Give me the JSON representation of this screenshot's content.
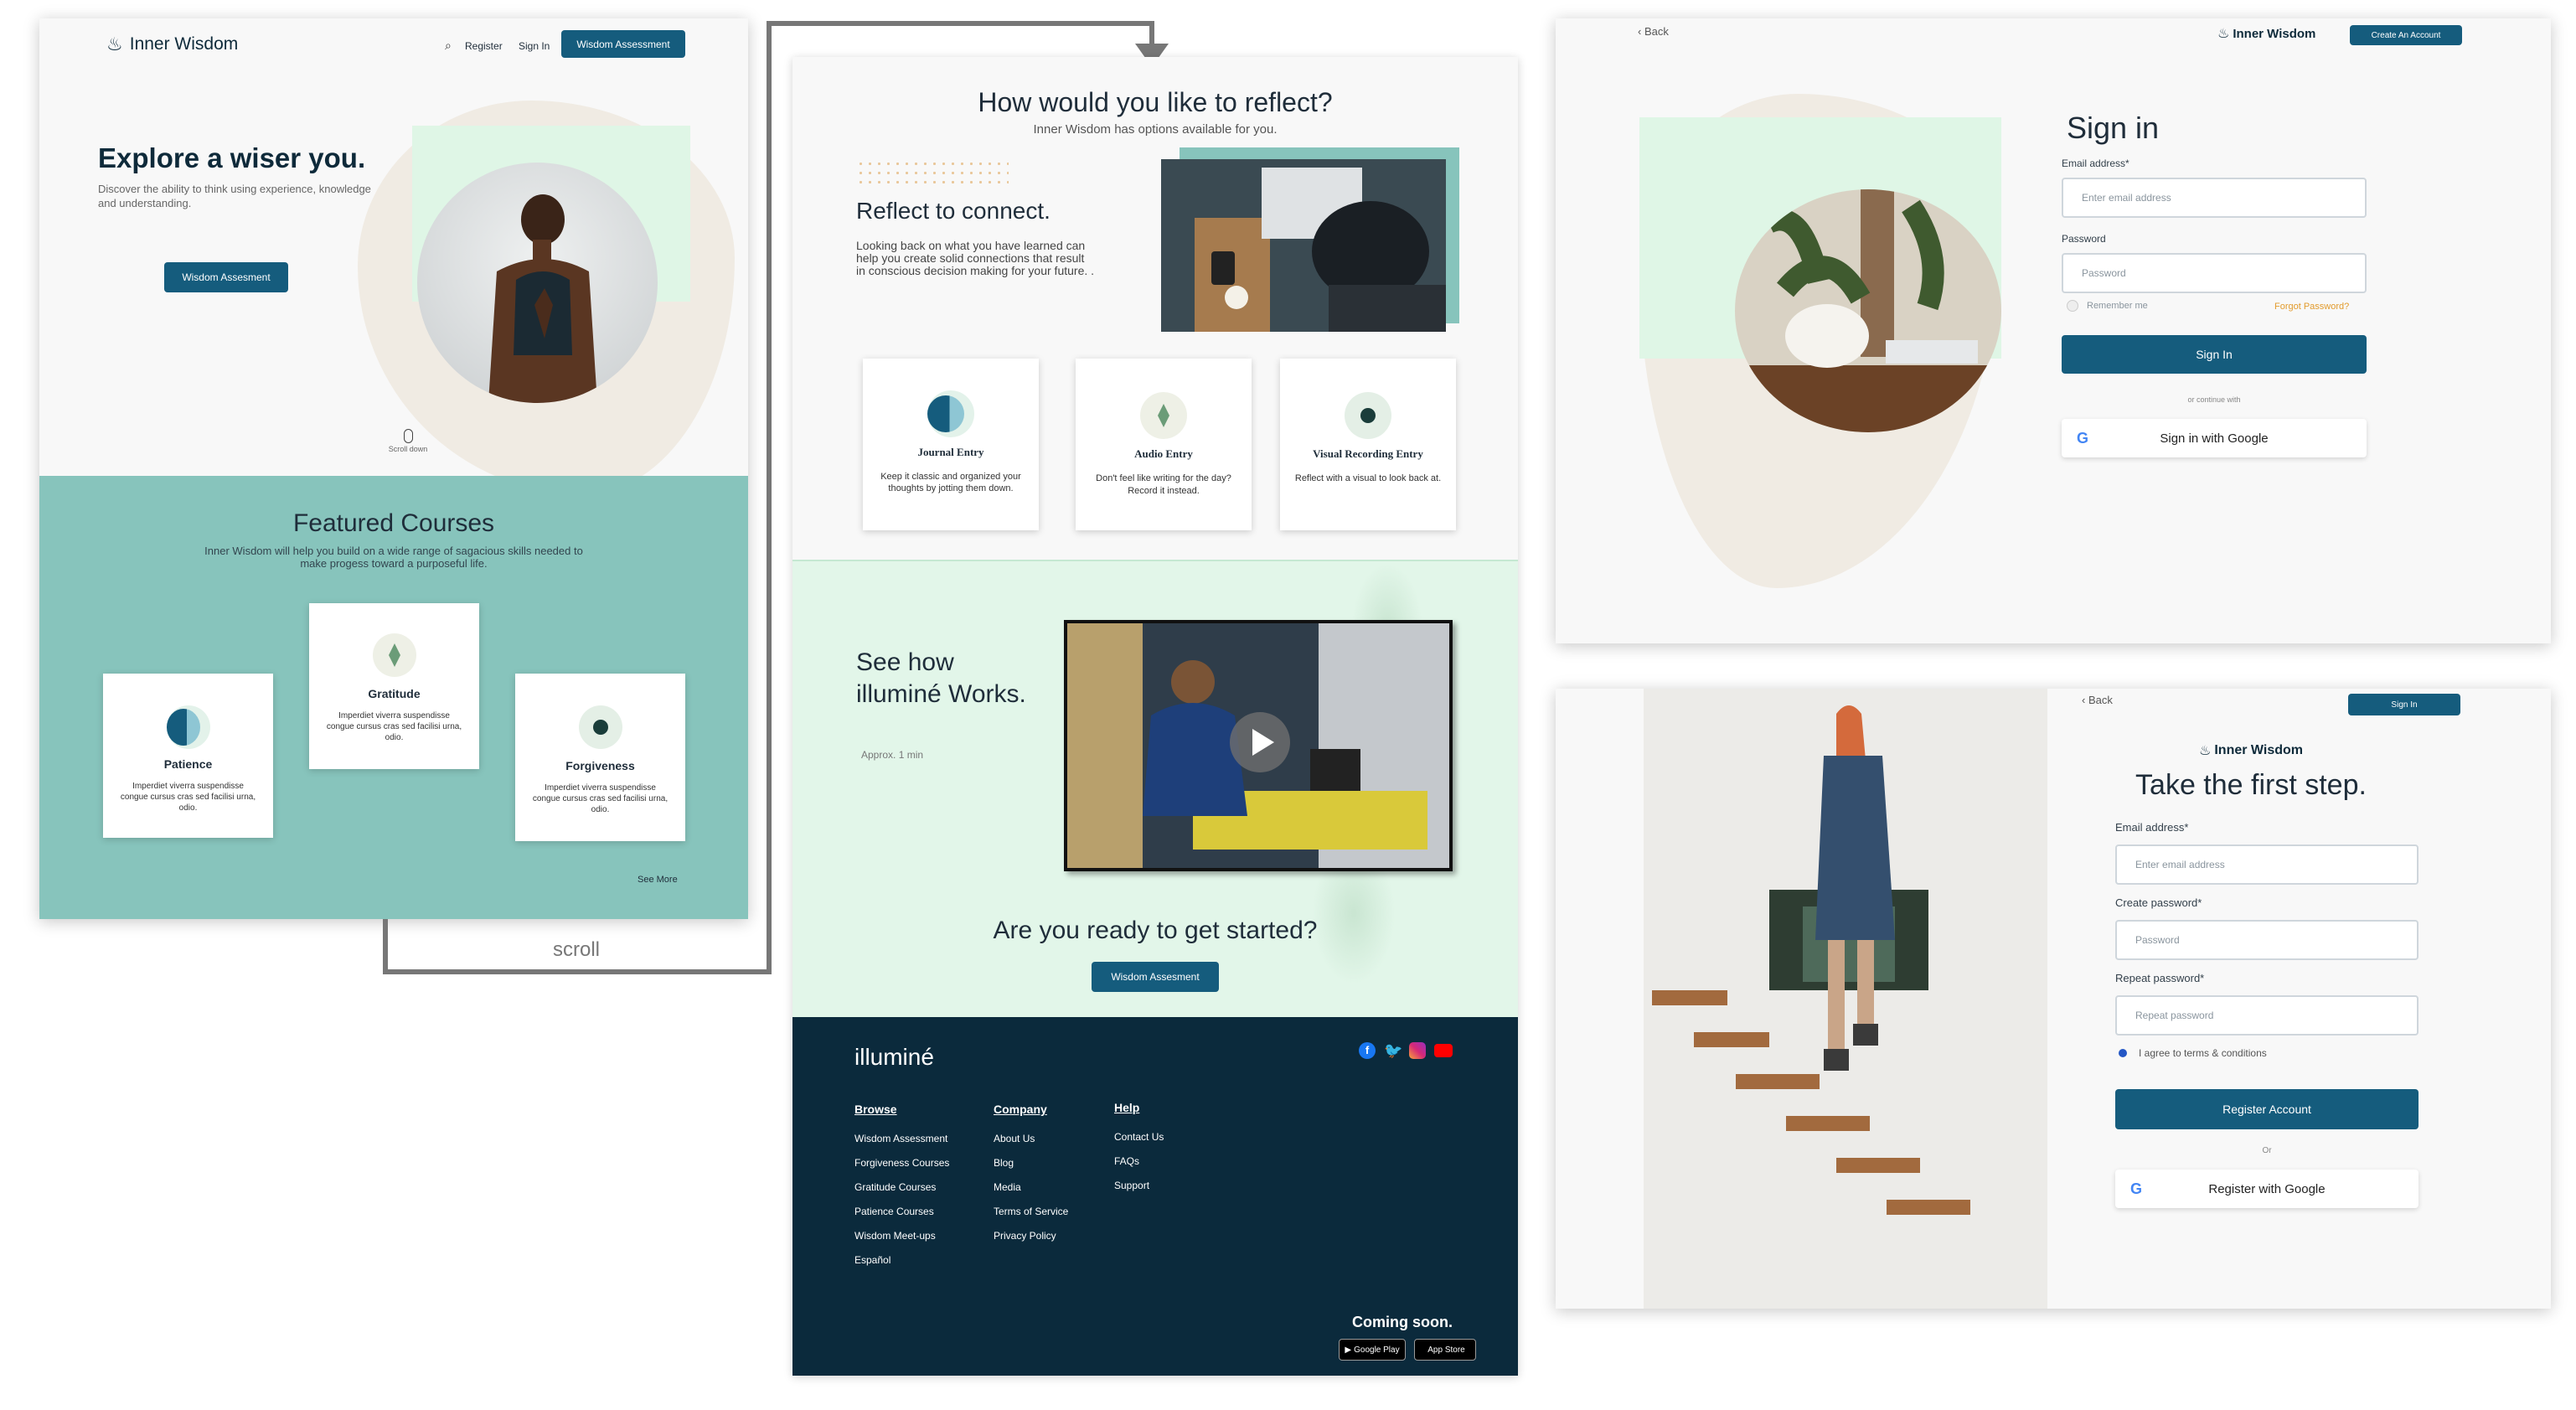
{
  "landing": {
    "brand": "Inner Wisdom",
    "nav": {
      "register": "Register",
      "sign_in": "Sign In",
      "cta": "Wisdom Assessment"
    },
    "hero": {
      "title": "Explore a wiser you.",
      "subtitle": "Discover the ability to think using experience, knowledge and understanding.",
      "cta": "Wisdom Assesment",
      "scroll": "Scroll down"
    },
    "featured": {
      "title": "Featured Courses",
      "subtitle": "Inner Wisdom will help you build on a wide range of sagacious skills needed to make progess toward a purposeful life.",
      "courses": [
        {
          "name": "Patience",
          "desc": "Imperdiet viverra suspendisse congue cursus cras sed facilisi urna, odio."
        },
        {
          "name": "Gratitude",
          "desc": "Imperdiet viverra suspendisse congue cursus cras sed facilisi urna, odio."
        },
        {
          "name": "Forgiveness",
          "desc": "Imperdiet viverra suspendisse congue cursus cras sed facilisi urna, odio."
        }
      ],
      "see_more": "See More"
    }
  },
  "connector": {
    "label": "scroll"
  },
  "scrolled": {
    "reflect_title": "How would you like to reflect?",
    "reflect_sub": "Inner Wisdom has options available for you.",
    "connect_title": "Reflect to connect.",
    "connect_body": "Looking back on what you have learned can help you create solid connections that result in conscious decision making for your future. .",
    "entries": [
      {
        "title": "Journal Entry",
        "desc": "Keep it classic and organized your thoughts by jotting them down."
      },
      {
        "title": "Audio Entry",
        "desc": "Don't feel like writing for the day? Record it instead."
      },
      {
        "title": "Visual Recording Entry",
        "desc": "Reflect with a visual to look back at."
      }
    ],
    "see_how_line1": "See how",
    "see_how_line2": "illuminé Works.",
    "approx": "Approx. 1 min",
    "ready": "Are you ready to get started?",
    "cta": "Wisdom Assesment",
    "footer": {
      "logo": "illuminé",
      "browse": {
        "title": "Browse",
        "links": [
          "Wisdom Assessment",
          "Forgiveness Courses",
          "Gratitude Courses",
          "Patience Courses",
          "Wisdom Meet-ups",
          "Español"
        ]
      },
      "company": {
        "title": "Company",
        "links": [
          "About Us",
          "Blog",
          "Media",
          "Terms of Service",
          "Privacy Policy"
        ]
      },
      "help": {
        "title": "Help",
        "links": [
          "Contact Us",
          "FAQs",
          "Support"
        ]
      },
      "coming_soon": "Coming soon.",
      "google_play": "Google Play",
      "app_store": "App Store"
    }
  },
  "signin": {
    "back": "Back",
    "brand": "Inner Wisdom",
    "create": "Create An Account",
    "title": "Sign in",
    "email_label": "Email address*",
    "email_ph": "Enter email address",
    "password_label": "Password",
    "password_ph": "Password",
    "remember": "Remember me",
    "forgot": "Forgot Password?",
    "submit": "Sign In",
    "or": "or continue with",
    "google": "Sign in with Google"
  },
  "register": {
    "back": "Back",
    "signin": "Sign In",
    "brand": "Inner Wisdom",
    "title": "Take the first step.",
    "email_label": "Email address*",
    "email_ph": "Enter email address",
    "create_label": "Create password*",
    "create_ph": "Password",
    "repeat_label": "Repeat password*",
    "repeat_ph": "Repeat password",
    "agree": "I agree to terms & conditions",
    "submit": "Register Account",
    "or": "Or",
    "google": "Register with Google"
  },
  "colors": {
    "primary": "#155c7d",
    "teal": "#87c4bc",
    "navy": "#0b2a3c",
    "mint": "#e2f6e9",
    "beige": "#f1ece4"
  }
}
